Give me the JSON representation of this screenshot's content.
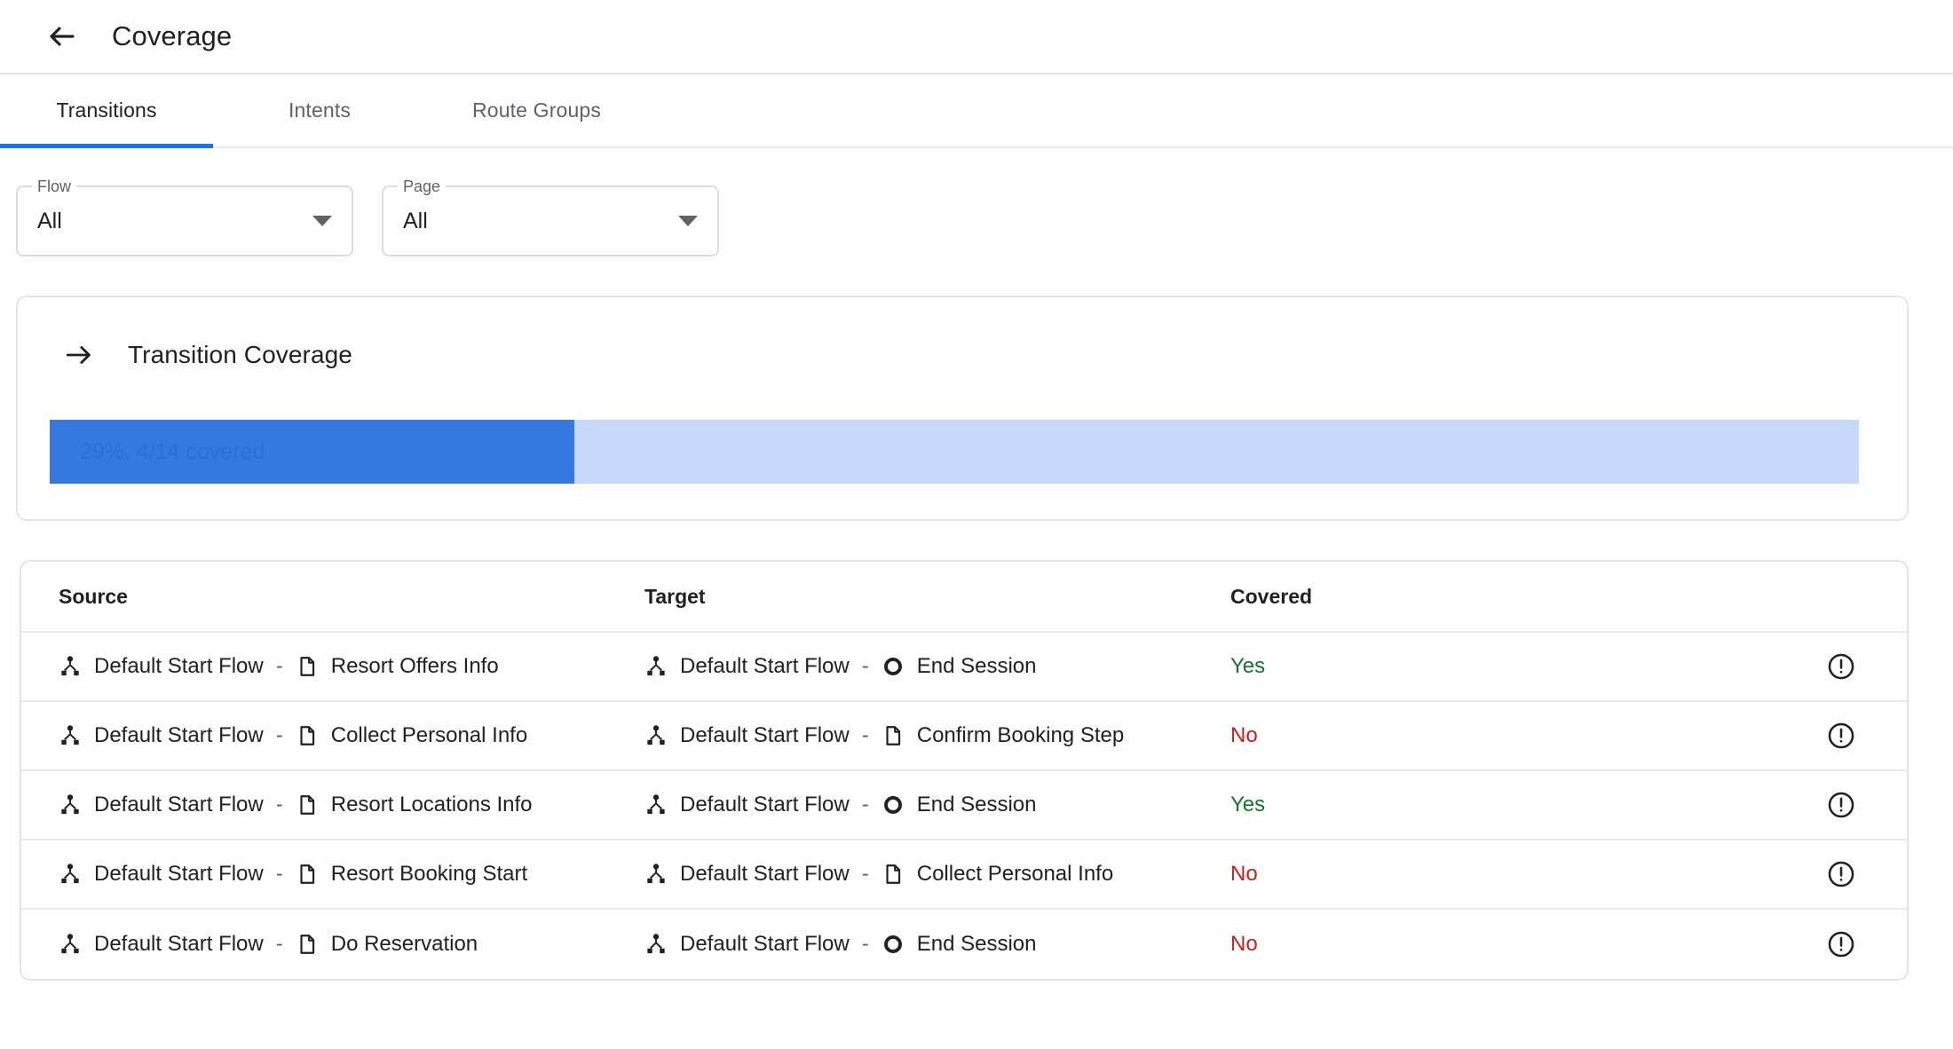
{
  "header": {
    "back_icon": "arrow-left-icon",
    "title": "Coverage"
  },
  "tabs": [
    {
      "label": "Transitions",
      "active": true
    },
    {
      "label": "Intents",
      "active": false
    },
    {
      "label": "Route Groups",
      "active": false
    }
  ],
  "filters": [
    {
      "legend": "Flow",
      "value": "All",
      "caret_icon": "chevron-down-icon"
    },
    {
      "legend": "Page",
      "value": "All",
      "caret_icon": "chevron-down-icon"
    }
  ],
  "coverage_card": {
    "icon": "arrow-right-icon",
    "title": "Transition Coverage",
    "percent": 29,
    "covered_count": 4,
    "total_count": 14,
    "progress_label": "29%, 4/14 covered",
    "fill_color": "#3478e0",
    "track_color": "#c6d9f8",
    "label_color": "#2b6ddb"
  },
  "table": {
    "columns": [
      "Source",
      "Target",
      "Covered"
    ],
    "row_action_icon": "error-circle-icon",
    "rows": [
      {
        "source": {
          "flow": "Default Start Flow",
          "flow_icon": "flow-icon",
          "separator": "-",
          "node": "Resort Offers Info",
          "node_icon": "page-icon"
        },
        "target": {
          "flow": "Default Start Flow",
          "flow_icon": "flow-icon",
          "separator": "-",
          "node": "End Session",
          "node_icon": "end-session-icon"
        },
        "covered": "Yes"
      },
      {
        "source": {
          "flow": "Default Start Flow",
          "flow_icon": "flow-icon",
          "separator": "-",
          "node": "Collect Personal Info",
          "node_icon": "page-icon"
        },
        "target": {
          "flow": "Default Start Flow",
          "flow_icon": "flow-icon",
          "separator": "-",
          "node": "Confirm Booking Step",
          "node_icon": "page-icon"
        },
        "covered": "No"
      },
      {
        "source": {
          "flow": "Default Start Flow",
          "flow_icon": "flow-icon",
          "separator": "-",
          "node": "Resort Locations Info",
          "node_icon": "page-icon"
        },
        "target": {
          "flow": "Default Start Flow",
          "flow_icon": "flow-icon",
          "separator": "-",
          "node": "End Session",
          "node_icon": "end-session-icon"
        },
        "covered": "Yes"
      },
      {
        "source": {
          "flow": "Default Start Flow",
          "flow_icon": "flow-icon",
          "separator": "-",
          "node": "Resort Booking Start",
          "node_icon": "page-icon"
        },
        "target": {
          "flow": "Default Start Flow",
          "flow_icon": "flow-icon",
          "separator": "-",
          "node": "Collect Personal Info",
          "node_icon": "page-icon"
        },
        "covered": "No"
      },
      {
        "source": {
          "flow": "Default Start Flow",
          "flow_icon": "flow-icon",
          "separator": "-",
          "node": "Do Reservation",
          "node_icon": "page-icon"
        },
        "target": {
          "flow": "Default Start Flow",
          "flow_icon": "flow-icon",
          "separator": "-",
          "node": "End Session",
          "node_icon": "end-session-icon"
        },
        "covered": "No"
      }
    ]
  },
  "colors": {
    "accent": "#1a73e8",
    "covered_yes": "#137333",
    "covered_no": "#c5221f"
  }
}
